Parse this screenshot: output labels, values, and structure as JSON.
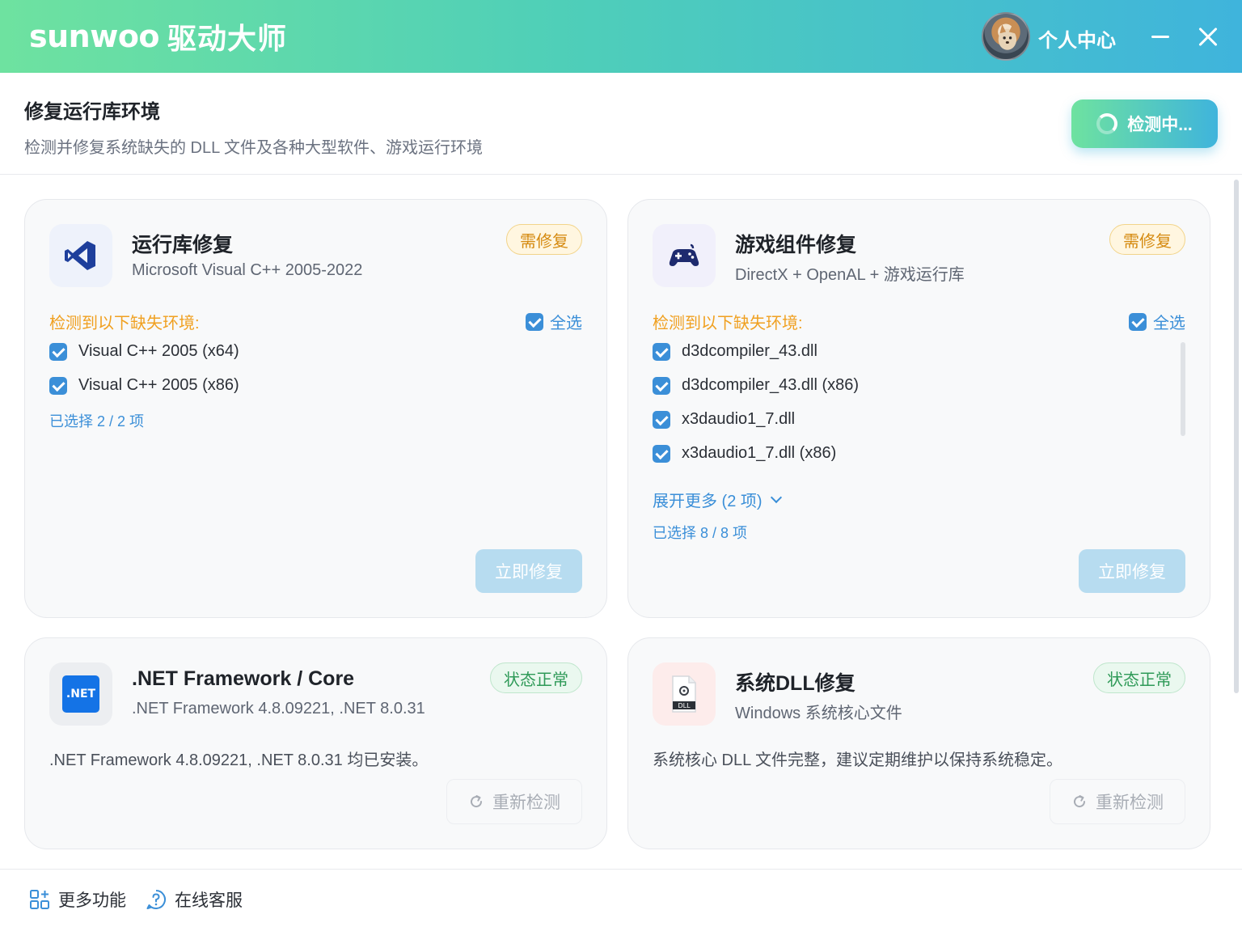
{
  "titlebar": {
    "brand_en": "sunwoo",
    "brand_cn": "驱动大师",
    "user_label": "个人中心"
  },
  "header": {
    "title": "修复运行库环境",
    "subtitle": "检测并修复系统缺失的 DLL 文件及各种大型软件、游戏运行环境",
    "detect_button": "检测中..."
  },
  "cards": {
    "runtime": {
      "title": "运行库修复",
      "subtitle": "Microsoft Visual C++ 2005-2022",
      "badge": "需修复",
      "missing_label": "检测到以下缺失环境:",
      "select_all": "全选",
      "items": [
        "Visual C++ 2005 (x64)",
        "Visual C++ 2005 (x86)"
      ],
      "selected_count": "已选择 2 / 2 项",
      "fix_button": "立即修复"
    },
    "game": {
      "title": "游戏组件修复",
      "subtitle": "DirectX + OpenAL + 游戏运行库",
      "badge": "需修复",
      "missing_label": "检测到以下缺失环境:",
      "select_all": "全选",
      "items": [
        "d3dcompiler_43.dll",
        "d3dcompiler_43.dll (x86)",
        "x3daudio1_7.dll",
        "x3daudio1_7.dll (x86)"
      ],
      "expand_more": "展开更多 (2 项)",
      "selected_count": "已选择 8 / 8 项",
      "fix_button": "立即修复"
    },
    "dotnet": {
      "icon_text": ".NET",
      "title": ".NET Framework / Core",
      "subtitle": ".NET Framework 4.8.09221, .NET 8.0.31",
      "badge": "状态正常",
      "description": ".NET Framework 4.8.09221, .NET 8.0.31 均已安装。",
      "recheck_button": "重新检测"
    },
    "dll": {
      "icon_text": "DLL",
      "title": "系统DLL修复",
      "subtitle": "Windows 系统核心文件",
      "badge": "状态正常",
      "description": "系统核心 DLL 文件完整，建议定期维护以保持系统稳定。",
      "recheck_button": "重新检测"
    }
  },
  "footer": {
    "more_features": "更多功能",
    "online_support": "在线客服"
  },
  "colors": {
    "gradient_start": "#6ee2a0",
    "gradient_end": "#3fb4dc",
    "accent_blue": "#3b8fd8",
    "warning_orange": "#f0a020",
    "ok_green": "#2f9a58"
  }
}
